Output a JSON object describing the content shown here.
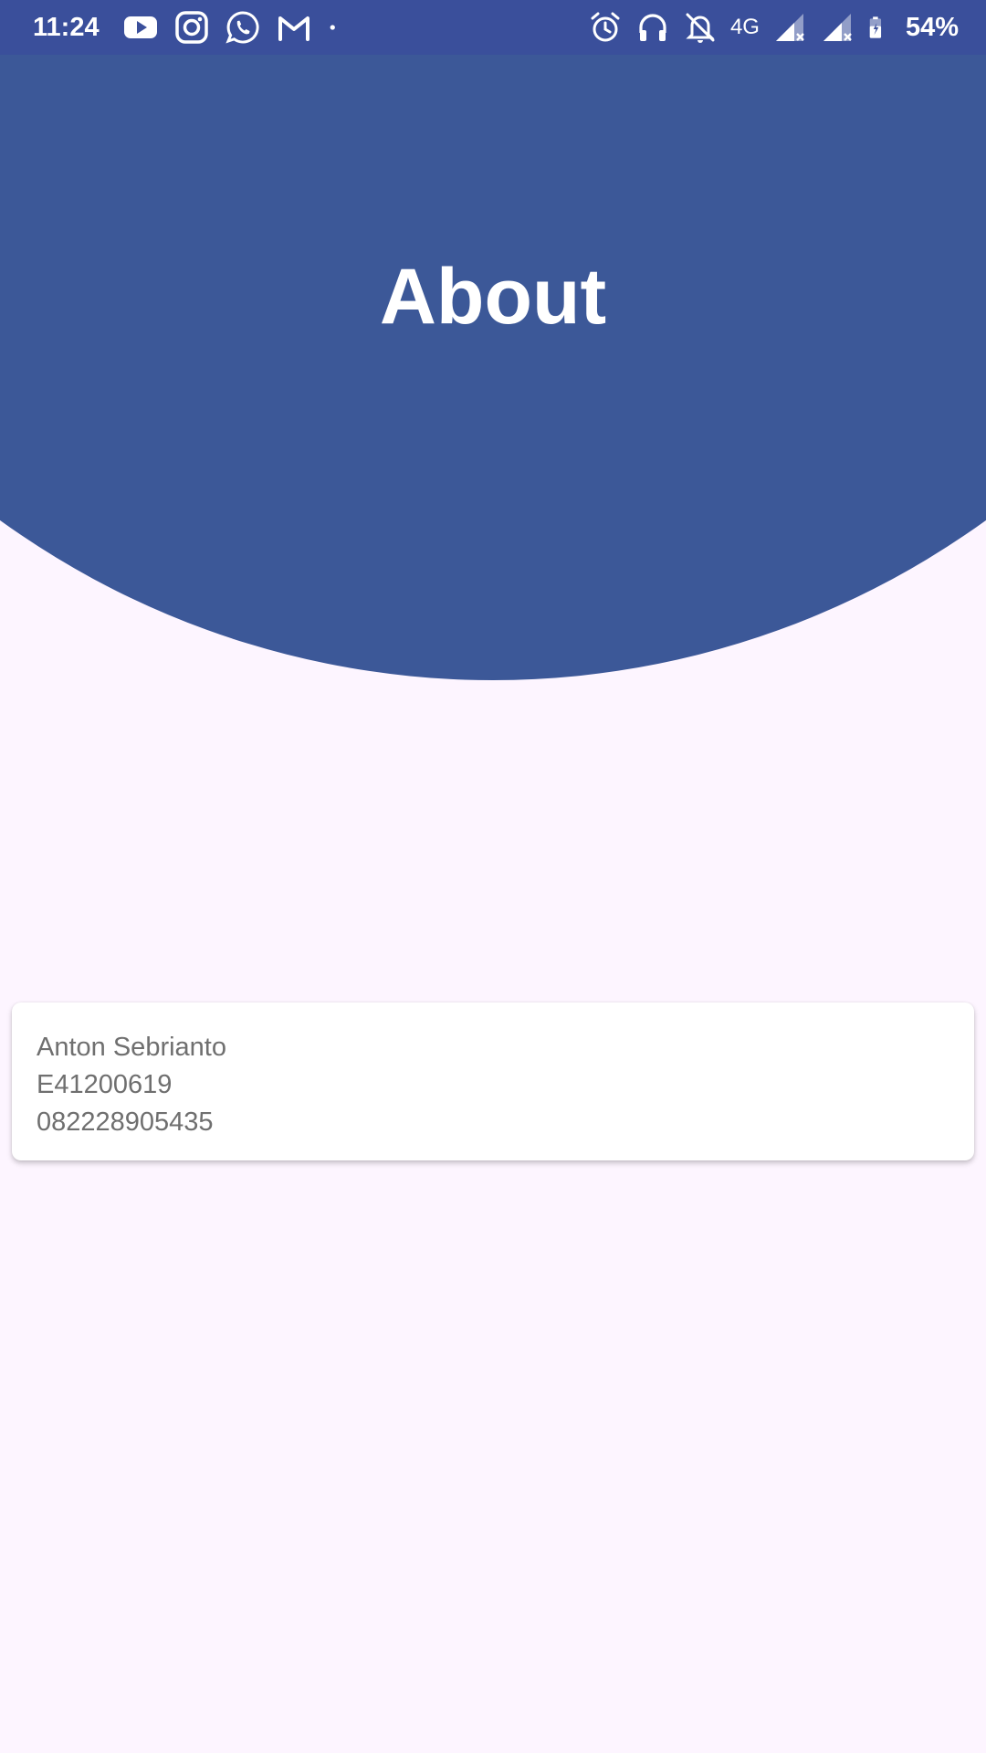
{
  "status_bar": {
    "time": "11:24",
    "network": "4G",
    "battery": "54%",
    "background": "#3a4f9b",
    "left_icons": [
      "youtube-icon",
      "instagram-icon",
      "whatsapp-icon",
      "gmail-icon",
      "dot-icon"
    ],
    "right_icons": [
      "alarm-icon",
      "headphones-icon",
      "bell-off-icon",
      "signal-icon",
      "signal-icon",
      "battery-icon"
    ]
  },
  "header": {
    "title": "About",
    "background": "#3c5898"
  },
  "card": {
    "name": "Anton Sebrianto",
    "id": "E41200619",
    "phone": "082228905435"
  },
  "colors": {
    "page_background": "#fdf5ff",
    "card_text": "#6f6f6f"
  }
}
